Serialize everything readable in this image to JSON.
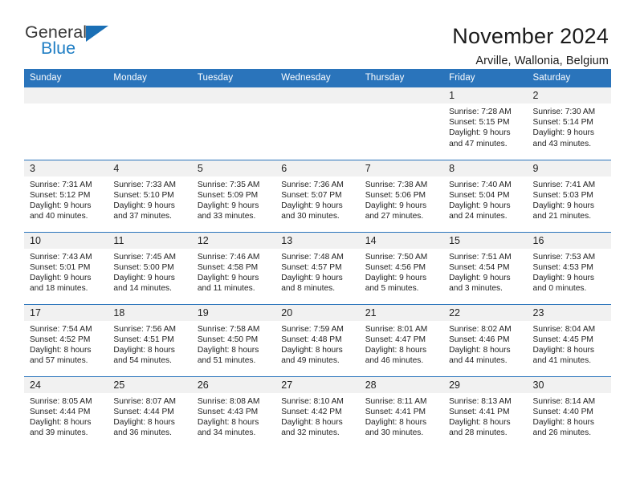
{
  "brand": {
    "name_part1": "General",
    "name_part2": "Blue",
    "accent_color": "#1a6fb5",
    "triangle_icon": "triangle-icon"
  },
  "header": {
    "month_title": "November 2024",
    "location": "Arville, Wallonia, Belgium"
  },
  "calendar": {
    "header_bg": "#2a74bb",
    "daynum_bg": "#f1f1f1",
    "weekday_labels": [
      "Sunday",
      "Monday",
      "Tuesday",
      "Wednesday",
      "Thursday",
      "Friday",
      "Saturday"
    ],
    "weeks": [
      [
        {
          "day": "",
          "empty": true
        },
        {
          "day": "",
          "empty": true
        },
        {
          "day": "",
          "empty": true
        },
        {
          "day": "",
          "empty": true
        },
        {
          "day": "",
          "empty": true
        },
        {
          "day": "1",
          "sunrise": "Sunrise: 7:28 AM",
          "sunset": "Sunset: 5:15 PM",
          "daylight_line1": "Daylight: 9 hours",
          "daylight_line2": "and 47 minutes."
        },
        {
          "day": "2",
          "sunrise": "Sunrise: 7:30 AM",
          "sunset": "Sunset: 5:14 PM",
          "daylight_line1": "Daylight: 9 hours",
          "daylight_line2": "and 43 minutes."
        }
      ],
      [
        {
          "day": "3",
          "sunrise": "Sunrise: 7:31 AM",
          "sunset": "Sunset: 5:12 PM",
          "daylight_line1": "Daylight: 9 hours",
          "daylight_line2": "and 40 minutes."
        },
        {
          "day": "4",
          "sunrise": "Sunrise: 7:33 AM",
          "sunset": "Sunset: 5:10 PM",
          "daylight_line1": "Daylight: 9 hours",
          "daylight_line2": "and 37 minutes."
        },
        {
          "day": "5",
          "sunrise": "Sunrise: 7:35 AM",
          "sunset": "Sunset: 5:09 PM",
          "daylight_line1": "Daylight: 9 hours",
          "daylight_line2": "and 33 minutes."
        },
        {
          "day": "6",
          "sunrise": "Sunrise: 7:36 AM",
          "sunset": "Sunset: 5:07 PM",
          "daylight_line1": "Daylight: 9 hours",
          "daylight_line2": "and 30 minutes."
        },
        {
          "day": "7",
          "sunrise": "Sunrise: 7:38 AM",
          "sunset": "Sunset: 5:06 PM",
          "daylight_line1": "Daylight: 9 hours",
          "daylight_line2": "and 27 minutes."
        },
        {
          "day": "8",
          "sunrise": "Sunrise: 7:40 AM",
          "sunset": "Sunset: 5:04 PM",
          "daylight_line1": "Daylight: 9 hours",
          "daylight_line2": "and 24 minutes."
        },
        {
          "day": "9",
          "sunrise": "Sunrise: 7:41 AM",
          "sunset": "Sunset: 5:03 PM",
          "daylight_line1": "Daylight: 9 hours",
          "daylight_line2": "and 21 minutes."
        }
      ],
      [
        {
          "day": "10",
          "sunrise": "Sunrise: 7:43 AM",
          "sunset": "Sunset: 5:01 PM",
          "daylight_line1": "Daylight: 9 hours",
          "daylight_line2": "and 18 minutes."
        },
        {
          "day": "11",
          "sunrise": "Sunrise: 7:45 AM",
          "sunset": "Sunset: 5:00 PM",
          "daylight_line1": "Daylight: 9 hours",
          "daylight_line2": "and 14 minutes."
        },
        {
          "day": "12",
          "sunrise": "Sunrise: 7:46 AM",
          "sunset": "Sunset: 4:58 PM",
          "daylight_line1": "Daylight: 9 hours",
          "daylight_line2": "and 11 minutes."
        },
        {
          "day": "13",
          "sunrise": "Sunrise: 7:48 AM",
          "sunset": "Sunset: 4:57 PM",
          "daylight_line1": "Daylight: 9 hours",
          "daylight_line2": "and 8 minutes."
        },
        {
          "day": "14",
          "sunrise": "Sunrise: 7:50 AM",
          "sunset": "Sunset: 4:56 PM",
          "daylight_line1": "Daylight: 9 hours",
          "daylight_line2": "and 5 minutes."
        },
        {
          "day": "15",
          "sunrise": "Sunrise: 7:51 AM",
          "sunset": "Sunset: 4:54 PM",
          "daylight_line1": "Daylight: 9 hours",
          "daylight_line2": "and 3 minutes."
        },
        {
          "day": "16",
          "sunrise": "Sunrise: 7:53 AM",
          "sunset": "Sunset: 4:53 PM",
          "daylight_line1": "Daylight: 9 hours",
          "daylight_line2": "and 0 minutes."
        }
      ],
      [
        {
          "day": "17",
          "sunrise": "Sunrise: 7:54 AM",
          "sunset": "Sunset: 4:52 PM",
          "daylight_line1": "Daylight: 8 hours",
          "daylight_line2": "and 57 minutes."
        },
        {
          "day": "18",
          "sunrise": "Sunrise: 7:56 AM",
          "sunset": "Sunset: 4:51 PM",
          "daylight_line1": "Daylight: 8 hours",
          "daylight_line2": "and 54 minutes."
        },
        {
          "day": "19",
          "sunrise": "Sunrise: 7:58 AM",
          "sunset": "Sunset: 4:50 PM",
          "daylight_line1": "Daylight: 8 hours",
          "daylight_line2": "and 51 minutes."
        },
        {
          "day": "20",
          "sunrise": "Sunrise: 7:59 AM",
          "sunset": "Sunset: 4:48 PM",
          "daylight_line1": "Daylight: 8 hours",
          "daylight_line2": "and 49 minutes."
        },
        {
          "day": "21",
          "sunrise": "Sunrise: 8:01 AM",
          "sunset": "Sunset: 4:47 PM",
          "daylight_line1": "Daylight: 8 hours",
          "daylight_line2": "and 46 minutes."
        },
        {
          "day": "22",
          "sunrise": "Sunrise: 8:02 AM",
          "sunset": "Sunset: 4:46 PM",
          "daylight_line1": "Daylight: 8 hours",
          "daylight_line2": "and 44 minutes."
        },
        {
          "day": "23",
          "sunrise": "Sunrise: 8:04 AM",
          "sunset": "Sunset: 4:45 PM",
          "daylight_line1": "Daylight: 8 hours",
          "daylight_line2": "and 41 minutes."
        }
      ],
      [
        {
          "day": "24",
          "sunrise": "Sunrise: 8:05 AM",
          "sunset": "Sunset: 4:44 PM",
          "daylight_line1": "Daylight: 8 hours",
          "daylight_line2": "and 39 minutes."
        },
        {
          "day": "25",
          "sunrise": "Sunrise: 8:07 AM",
          "sunset": "Sunset: 4:44 PM",
          "daylight_line1": "Daylight: 8 hours",
          "daylight_line2": "and 36 minutes."
        },
        {
          "day": "26",
          "sunrise": "Sunrise: 8:08 AM",
          "sunset": "Sunset: 4:43 PM",
          "daylight_line1": "Daylight: 8 hours",
          "daylight_line2": "and 34 minutes."
        },
        {
          "day": "27",
          "sunrise": "Sunrise: 8:10 AM",
          "sunset": "Sunset: 4:42 PM",
          "daylight_line1": "Daylight: 8 hours",
          "daylight_line2": "and 32 minutes."
        },
        {
          "day": "28",
          "sunrise": "Sunrise: 8:11 AM",
          "sunset": "Sunset: 4:41 PM",
          "daylight_line1": "Daylight: 8 hours",
          "daylight_line2": "and 30 minutes."
        },
        {
          "day": "29",
          "sunrise": "Sunrise: 8:13 AM",
          "sunset": "Sunset: 4:41 PM",
          "daylight_line1": "Daylight: 8 hours",
          "daylight_line2": "and 28 minutes."
        },
        {
          "day": "30",
          "sunrise": "Sunrise: 8:14 AM",
          "sunset": "Sunset: 4:40 PM",
          "daylight_line1": "Daylight: 8 hours",
          "daylight_line2": "and 26 minutes."
        }
      ]
    ]
  }
}
